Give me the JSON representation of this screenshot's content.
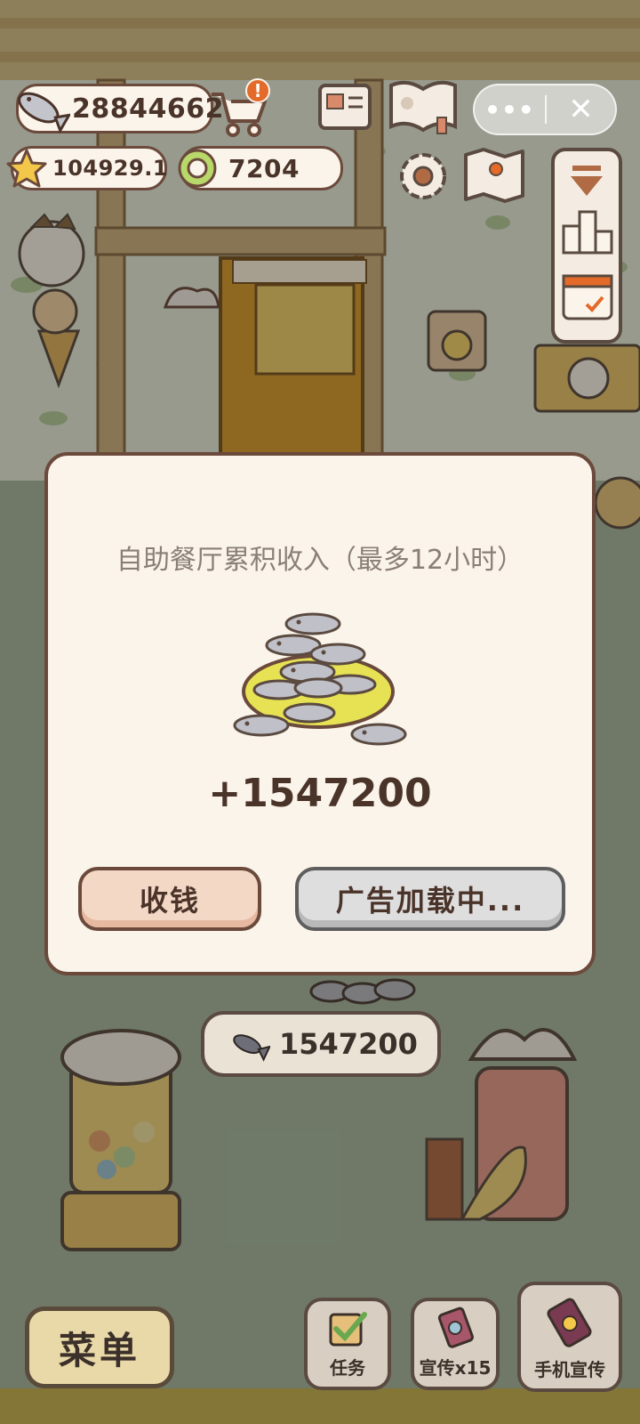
{
  "hud": {
    "fish_count": "28844662",
    "star_count": "104929.1",
    "coin_count": "7204",
    "alert_mark": "!"
  },
  "mini_program": {
    "more_label": "•••",
    "close_label": "✕"
  },
  "modal": {
    "title": "自助餐厅累积收入（最多12小时）",
    "amount": "+1547200",
    "collect_label": "收钱",
    "ad_label": "广告加载中..."
  },
  "scene": {
    "buffet_counter_value": "1547200"
  },
  "bottom_bar": {
    "menu_label": "菜单",
    "tasks_label": "任务",
    "promo_label": "宣传x15",
    "phone_promo_label": "手机宣传"
  },
  "icons": {
    "fish": "fish-icon",
    "cart": "cart-icon",
    "star": "star-icon",
    "coin": "coin-icon",
    "mail": "mail-icon",
    "book": "paw-book-icon",
    "settings": "gear-icon",
    "map": "map-icon",
    "collapse": "collapse-arrow-icon",
    "ranking": "ranking-icon",
    "calendar": "calendar-icon",
    "task": "checkbox-icon",
    "ad": "ad-card-icon",
    "phone": "phone-icon"
  },
  "colors": {
    "panel_bg": "#fbf4ea",
    "border_brown": "#6b4a3c",
    "text_dark": "#4a3329",
    "collect_btn": "#f3d8c6",
    "ad_btn": "#dedede",
    "plate_yellow": "#e7e253"
  }
}
